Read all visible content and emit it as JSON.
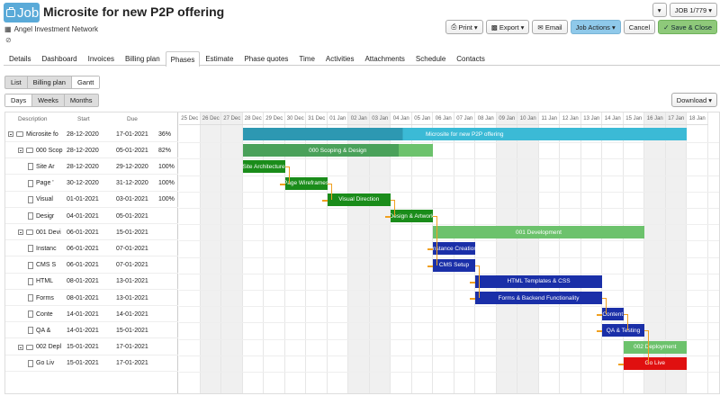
{
  "header": {
    "job_badge": "Job",
    "title": "Microsite for new P2P offering",
    "client": "Angel Investment Network",
    "job_number": "JOB 1/779"
  },
  "actions": {
    "print": "Print",
    "export": "Export",
    "email": "Email",
    "job_actions": "Job Actions",
    "cancel": "Cancel",
    "save_close": "Save & Close"
  },
  "tabs": [
    "Details",
    "Dashboard",
    "Invoices",
    "Billing plan",
    "Phases",
    "Estimate",
    "Phase quotes",
    "Time",
    "Activities",
    "Attachments",
    "Schedule",
    "Contacts"
  ],
  "active_tab": "Phases",
  "view_modes": [
    "List",
    "Billing plan",
    "Gantt"
  ],
  "active_view": "Gantt",
  "scales": [
    "Days",
    "Weeks",
    "Months"
  ],
  "active_scale": "Days",
  "download": "Download",
  "columns": {
    "description": "Description",
    "start": "Start",
    "due": "Due"
  },
  "rows": [
    {
      "desc": "Microsite fo",
      "start": "28-12-2020",
      "due": "17-01-2021",
      "pct": "36%",
      "lvl": 0,
      "kind": "group"
    },
    {
      "desc": "000 Scop",
      "start": "28-12-2020",
      "due": "05-01-2021",
      "pct": "82%",
      "lvl": 1,
      "kind": "group"
    },
    {
      "desc": "Site Ar",
      "start": "28-12-2020",
      "due": "29-12-2020",
      "pct": "100%",
      "lvl": 2,
      "kind": "task"
    },
    {
      "desc": "Page '",
      "start": "30-12-2020",
      "due": "31-12-2020",
      "pct": "100%",
      "lvl": 2,
      "kind": "task"
    },
    {
      "desc": "Visual",
      "start": "01-01-2021",
      "due": "03-01-2021",
      "pct": "100%",
      "lvl": 2,
      "kind": "task"
    },
    {
      "desc": "Desigr",
      "start": "04-01-2021",
      "due": "05-01-2021",
      "pct": "",
      "lvl": 2,
      "kind": "task"
    },
    {
      "desc": "001 Devi",
      "start": "06-01-2021",
      "due": "15-01-2021",
      "pct": "",
      "lvl": 1,
      "kind": "group"
    },
    {
      "desc": "Instanc",
      "start": "06-01-2021",
      "due": "07-01-2021",
      "pct": "",
      "lvl": 2,
      "kind": "task"
    },
    {
      "desc": "CMS S",
      "start": "06-01-2021",
      "due": "07-01-2021",
      "pct": "",
      "lvl": 2,
      "kind": "task"
    },
    {
      "desc": "HTML",
      "start": "08-01-2021",
      "due": "13-01-2021",
      "pct": "",
      "lvl": 2,
      "kind": "task"
    },
    {
      "desc": "Forms",
      "start": "08-01-2021",
      "due": "13-01-2021",
      "pct": "",
      "lvl": 2,
      "kind": "task"
    },
    {
      "desc": "Conte",
      "start": "14-01-2021",
      "due": "14-01-2021",
      "pct": "",
      "lvl": 2,
      "kind": "task"
    },
    {
      "desc": "QA &",
      "start": "14-01-2021",
      "due": "15-01-2021",
      "pct": "",
      "lvl": 2,
      "kind": "task"
    },
    {
      "desc": "002 Depl",
      "start": "15-01-2021",
      "due": "17-01-2021",
      "pct": "",
      "lvl": 1,
      "kind": "group"
    },
    {
      "desc": "Go Liv",
      "start": "15-01-2021",
      "due": "17-01-2021",
      "pct": "",
      "lvl": 2,
      "kind": "task"
    }
  ],
  "days": [
    "25 Dec",
    "26 Dec",
    "27 Dec",
    "28 Dec",
    "29 Dec",
    "30 Dec",
    "31 Dec",
    "01 Jan",
    "02 Jan",
    "03 Jan",
    "04 Jan",
    "05 Jan",
    "06 Jan",
    "07 Jan",
    "08 Jan",
    "09 Jan",
    "10 Jan",
    "11 Jan",
    "12 Jan",
    "13 Jan",
    "14 Jan",
    "15 Jan",
    "16 Jan",
    "17 Jan",
    "18 Jan"
  ],
  "weekend_days": [
    "26 Dec",
    "27 Dec",
    "02 Jan",
    "03 Jan",
    "09 Jan",
    "10 Jan",
    "16 Jan",
    "17 Jan"
  ],
  "bars": [
    {
      "row": 0,
      "label": "Microsite for new P2P offering",
      "start": "28 Dec",
      "end": "17 Jan",
      "color": "#3bbad6",
      "progress": 0.36,
      "progress_color": "#2d98b2"
    },
    {
      "row": 1,
      "label": "000 Scoping & Design",
      "start": "28 Dec",
      "end": "05 Jan",
      "color": "#6cc26c",
      "progress": 0.82,
      "progress_color": "#4aa15a"
    },
    {
      "row": 2,
      "label": "Site Architecture",
      "start": "28 Dec",
      "end": "29 Dec",
      "color": "#1a8c1a"
    },
    {
      "row": 3,
      "label": "Page Wireframes",
      "start": "30 Dec",
      "end": "31 Dec",
      "color": "#1a8c1a"
    },
    {
      "row": 4,
      "label": "Visual Direction",
      "start": "01 Jan",
      "end": "03 Jan",
      "color": "#1a8c1a"
    },
    {
      "row": 5,
      "label": "Design & Artwork",
      "start": "04 Jan",
      "end": "05 Jan",
      "color": "#1a8c1a"
    },
    {
      "row": 6,
      "label": "001 Development",
      "start": "06 Jan",
      "end": "15 Jan",
      "color": "#6cc26c"
    },
    {
      "row": 7,
      "label": "Instance Creation",
      "start": "06 Jan",
      "end": "07 Jan",
      "color": "#1a2fa8"
    },
    {
      "row": 8,
      "label": "CMS Setup",
      "start": "06 Jan",
      "end": "07 Jan",
      "color": "#1a2fa8"
    },
    {
      "row": 9,
      "label": "HTML Templates & CSS",
      "start": "08 Jan",
      "end": "13 Jan",
      "color": "#1a2fa8"
    },
    {
      "row": 10,
      "label": "Forms & Backend Functionality",
      "start": "08 Jan",
      "end": "13 Jan",
      "color": "#1a2fa8"
    },
    {
      "row": 11,
      "label": "Content",
      "start": "14 Jan",
      "end": "14 Jan",
      "color": "#1a2fa8"
    },
    {
      "row": 12,
      "label": "QA & Testing",
      "start": "14 Jan",
      "end": "15 Jan",
      "color": "#1a2fa8"
    },
    {
      "row": 13,
      "label": "002 Deployment",
      "start": "15 Jan",
      "end": "17 Jan",
      "color": "#6cc26c"
    },
    {
      "row": 14,
      "label": "Go Live",
      "start": "15 Jan",
      "end": "17 Jan",
      "color": "#e01010"
    }
  ],
  "dependencies": [
    [
      2,
      3
    ],
    [
      3,
      4
    ],
    [
      4,
      5
    ],
    [
      5,
      7
    ],
    [
      5,
      8
    ],
    [
      8,
      9
    ],
    [
      8,
      10
    ],
    [
      10,
      11
    ],
    [
      11,
      12
    ],
    [
      12,
      14
    ]
  ],
  "colors": {
    "connector": "#f0a020",
    "accent": "#5aaad8"
  }
}
